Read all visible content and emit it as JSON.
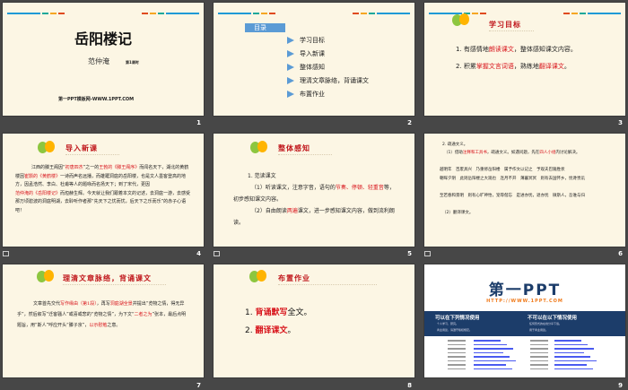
{
  "slides": [
    {
      "number": "1",
      "title": "岳阳楼记",
      "author": "范仲淹",
      "lesson": "第1课时",
      "footer": "第一PPT模板网-WWW.1PPT.COM"
    },
    {
      "number": "2",
      "toc_title": "目录",
      "items": [
        "学习目标",
        "导入新课",
        "整体感知",
        "理清文章脉络，背诵课文",
        "布置作业"
      ]
    },
    {
      "number": "3",
      "heading": "学习目标",
      "lines": [
        [
          "1. 有感情地",
          "朗读课文",
          "，整体感知课文内容。"
        ],
        [
          "2. 积累",
          "掌握文言词语",
          "，熟练地",
          "翻译课文",
          "。"
        ]
      ]
    },
    {
      "number": "4",
      "heading": "导入新课",
      "text": [
        "江西的滕王阁因“",
        "初唐四杰",
        "”之一的",
        "王勃的《滕王阁序》",
        "而闻名天下，湖北的黄鹤楼因",
        "崔颢的《黄鹤楼》",
        "一诗而声名远播，而雄踞洞庭的岳阳楼，也是文人墨客登高的地方，因孟浩然、李白、杜甫等人的题咏而名扬天下；到了宋代，更因",
        "范仲淹的《岳阳楼记》",
        "而烜赫生辉。今天就让我们跟着本文的记述，去洞庭一游，去感受那万顷碧波的洞庭明湖，去聆听作者那“先天下之忧而忧，后天下之乐而乐”的赤子心语吧！"
      ]
    },
    {
      "number": "5",
      "heading": "整体感知",
      "l1": "1. 范读课文",
      "l2": [
        "（1）听读课文，注意字音，语句的",
        "节奏、停顿、轻重音",
        "等，初步感知课文内容。"
      ],
      "l3": [
        "（2）自由朗读",
        "两遍",
        "课文，进一步感知课文内容，做到流利朗读。"
      ]
    },
    {
      "number": "6",
      "l1": "2. 疏通文义。",
      "l2": [
        "（1）借助",
        "注释和工具书",
        "，疏通文义。如遇问题，先在",
        "四人小组",
        "内讨论解决。"
      ],
      "l3": "越明年　百废具兴　乃重修岳阳楼　属予作文以记之　予观夫巴陵胜状",
      "l4": "朝晖夕阴　此则岳阳楼之大观也　连月不开　薄暮冥冥　则有去国怀乡，忧谗畏讥",
      "l5": "至若春和景明　则有心旷神怡，宠辱偕忘　是进亦忧，退亦忧　微斯人，吾谁与归",
      "l6": "（2）翻译课文。"
    },
    {
      "number": "7",
      "heading": "理清文章脉络，背诵课文",
      "text": [
        "文章首先交代",
        "写作缘由（第1段）",
        "，再写",
        "洞庭湖全景",
        "并提出“览物之情，得无异乎”，然后叙写“迁客骚人”或喜或悲的“览物之情”，为下文“",
        "二者之为",
        "”张本，最后点明题旨，用“斯人”呼应开头“滕子京”，",
        "以示慰勉",
        "之意。"
      ]
    },
    {
      "number": "8",
      "heading": "布置作业",
      "l1": [
        "1. ",
        "背诵默写",
        "全文。"
      ],
      "l2": [
        "2. ",
        "翻译课文",
        "。"
      ]
    },
    {
      "number": "9",
      "logo": "第一PPT",
      "url": "HTTP://WWW.1PPT.COM",
      "can_use": "可以在下列情况使用",
      "can_items": [
        "个人学习、研究。",
        "商业用途，请遵守版权规定。"
      ],
      "cannot_use": "不可以在以下情况使用",
      "cannot_items": [
        "任何形式的在线分享下载。",
        "用于商业用途。"
      ]
    }
  ],
  "colors": {
    "accent_red": "#d8141b",
    "bar_blue": "#1f9ad6",
    "bar_teal": "#1aa89a",
    "bar_orange": "#f5a623",
    "bar_red": "#e04a1f",
    "banner": "#1c3d6a"
  }
}
